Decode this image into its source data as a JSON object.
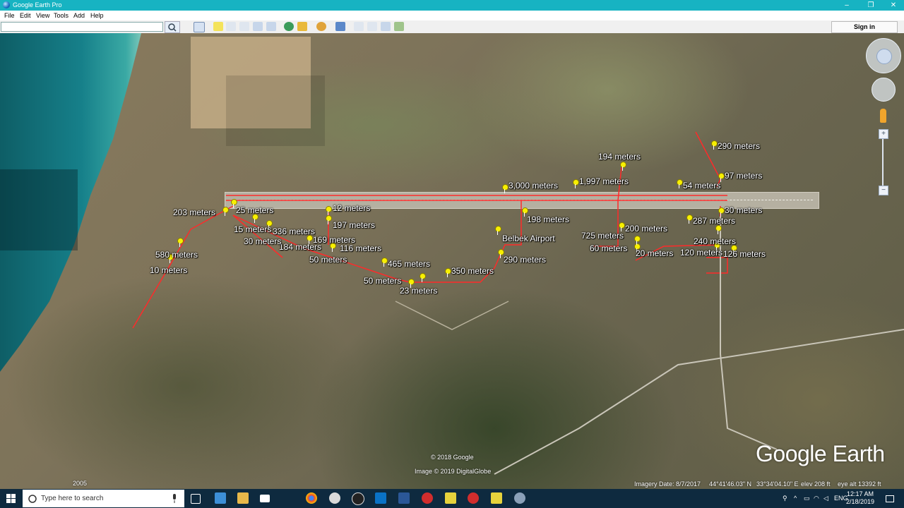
{
  "window": {
    "title": "Google Earth Pro",
    "minimize": "–",
    "maximize": "❐",
    "close": "✕"
  },
  "menu": [
    "File",
    "Edit",
    "View",
    "Tools",
    "Add",
    "Help"
  ],
  "toolbar": {
    "search_placeholder": "",
    "sign_in": "Sign in"
  },
  "map": {
    "labels": [
      {
        "text": "3,000 meters"
      },
      {
        "text": "1,997 meters"
      },
      {
        "text": "194 meters"
      },
      {
        "text": "290 meters"
      },
      {
        "text": "97 meters"
      },
      {
        "text": "54 meters"
      },
      {
        "text": "30 meters"
      },
      {
        "text": "287 meters"
      },
      {
        "text": "240 meters"
      },
      {
        "text": "126 meters"
      },
      {
        "text": "120 meters"
      },
      {
        "text": "20 meters"
      },
      {
        "text": "60 meters"
      },
      {
        "text": "725 meters"
      },
      {
        "text": "200 meters"
      },
      {
        "text": "198 meters"
      },
      {
        "text": "Belbek Airport"
      },
      {
        "text": "290 meters"
      },
      {
        "text": "350 meters"
      },
      {
        "text": "465 meters"
      },
      {
        "text": "50 meters"
      },
      {
        "text": "23 meters"
      },
      {
        "text": "50 meters"
      },
      {
        "text": "116 meters"
      },
      {
        "text": "169 meters"
      },
      {
        "text": "184 meters"
      },
      {
        "text": "336 meters"
      },
      {
        "text": "12 meters"
      },
      {
        "text": "197 meters"
      },
      {
        "text": "25 meters"
      },
      {
        "text": "203 meters"
      },
      {
        "text": "15 meters"
      },
      {
        "text": "30 meters"
      },
      {
        "text": "580 meters"
      },
      {
        "text": "10 meters"
      }
    ],
    "logo": "Google Earth",
    "copyright": "© 2018 Google",
    "imagery": "Image © 2019 DigitalGlobe",
    "year": "2005",
    "status": {
      "imagery_date": "Imagery Date: 8/7/2017",
      "lat": "44°41'46.03\" N",
      "lon": "33°34'04.10\" E",
      "elev": "elev  208 ft",
      "eye_alt": "eye alt  13392 ft"
    }
  },
  "taskbar": {
    "search_placeholder": "Type here to search",
    "lang": "ENG",
    "time": "12:17 AM",
    "date": "2/18/2019"
  }
}
